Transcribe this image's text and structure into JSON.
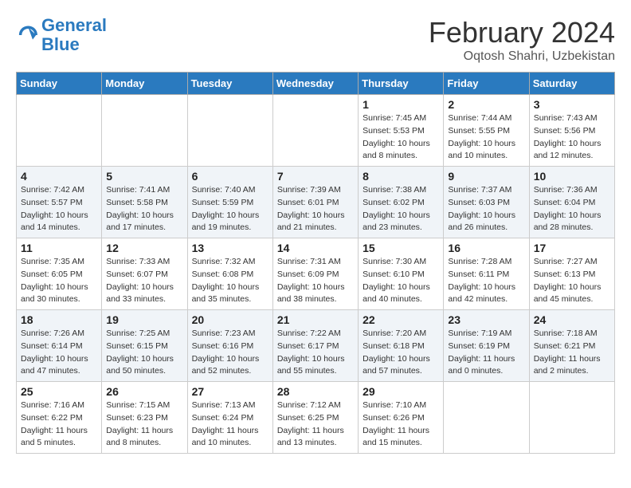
{
  "header": {
    "logo_line1": "General",
    "logo_line2": "Blue",
    "title": "February 2024",
    "subtitle": "Oqtosh Shahri, Uzbekistan"
  },
  "days_of_week": [
    "Sunday",
    "Monday",
    "Tuesday",
    "Wednesday",
    "Thursday",
    "Friday",
    "Saturday"
  ],
  "weeks": [
    [
      {
        "day": "",
        "info": ""
      },
      {
        "day": "",
        "info": ""
      },
      {
        "day": "",
        "info": ""
      },
      {
        "day": "",
        "info": ""
      },
      {
        "day": "1",
        "info": "Sunrise: 7:45 AM\nSunset: 5:53 PM\nDaylight: 10 hours\nand 8 minutes."
      },
      {
        "day": "2",
        "info": "Sunrise: 7:44 AM\nSunset: 5:55 PM\nDaylight: 10 hours\nand 10 minutes."
      },
      {
        "day": "3",
        "info": "Sunrise: 7:43 AM\nSunset: 5:56 PM\nDaylight: 10 hours\nand 12 minutes."
      }
    ],
    [
      {
        "day": "4",
        "info": "Sunrise: 7:42 AM\nSunset: 5:57 PM\nDaylight: 10 hours\nand 14 minutes."
      },
      {
        "day": "5",
        "info": "Sunrise: 7:41 AM\nSunset: 5:58 PM\nDaylight: 10 hours\nand 17 minutes."
      },
      {
        "day": "6",
        "info": "Sunrise: 7:40 AM\nSunset: 5:59 PM\nDaylight: 10 hours\nand 19 minutes."
      },
      {
        "day": "7",
        "info": "Sunrise: 7:39 AM\nSunset: 6:01 PM\nDaylight: 10 hours\nand 21 minutes."
      },
      {
        "day": "8",
        "info": "Sunrise: 7:38 AM\nSunset: 6:02 PM\nDaylight: 10 hours\nand 23 minutes."
      },
      {
        "day": "9",
        "info": "Sunrise: 7:37 AM\nSunset: 6:03 PM\nDaylight: 10 hours\nand 26 minutes."
      },
      {
        "day": "10",
        "info": "Sunrise: 7:36 AM\nSunset: 6:04 PM\nDaylight: 10 hours\nand 28 minutes."
      }
    ],
    [
      {
        "day": "11",
        "info": "Sunrise: 7:35 AM\nSunset: 6:05 PM\nDaylight: 10 hours\nand 30 minutes."
      },
      {
        "day": "12",
        "info": "Sunrise: 7:33 AM\nSunset: 6:07 PM\nDaylight: 10 hours\nand 33 minutes."
      },
      {
        "day": "13",
        "info": "Sunrise: 7:32 AM\nSunset: 6:08 PM\nDaylight: 10 hours\nand 35 minutes."
      },
      {
        "day": "14",
        "info": "Sunrise: 7:31 AM\nSunset: 6:09 PM\nDaylight: 10 hours\nand 38 minutes."
      },
      {
        "day": "15",
        "info": "Sunrise: 7:30 AM\nSunset: 6:10 PM\nDaylight: 10 hours\nand 40 minutes."
      },
      {
        "day": "16",
        "info": "Sunrise: 7:28 AM\nSunset: 6:11 PM\nDaylight: 10 hours\nand 42 minutes."
      },
      {
        "day": "17",
        "info": "Sunrise: 7:27 AM\nSunset: 6:13 PM\nDaylight: 10 hours\nand 45 minutes."
      }
    ],
    [
      {
        "day": "18",
        "info": "Sunrise: 7:26 AM\nSunset: 6:14 PM\nDaylight: 10 hours\nand 47 minutes."
      },
      {
        "day": "19",
        "info": "Sunrise: 7:25 AM\nSunset: 6:15 PM\nDaylight: 10 hours\nand 50 minutes."
      },
      {
        "day": "20",
        "info": "Sunrise: 7:23 AM\nSunset: 6:16 PM\nDaylight: 10 hours\nand 52 minutes."
      },
      {
        "day": "21",
        "info": "Sunrise: 7:22 AM\nSunset: 6:17 PM\nDaylight: 10 hours\nand 55 minutes."
      },
      {
        "day": "22",
        "info": "Sunrise: 7:20 AM\nSunset: 6:18 PM\nDaylight: 10 hours\nand 57 minutes."
      },
      {
        "day": "23",
        "info": "Sunrise: 7:19 AM\nSunset: 6:19 PM\nDaylight: 11 hours\nand 0 minutes."
      },
      {
        "day": "24",
        "info": "Sunrise: 7:18 AM\nSunset: 6:21 PM\nDaylight: 11 hours\nand 2 minutes."
      }
    ],
    [
      {
        "day": "25",
        "info": "Sunrise: 7:16 AM\nSunset: 6:22 PM\nDaylight: 11 hours\nand 5 minutes."
      },
      {
        "day": "26",
        "info": "Sunrise: 7:15 AM\nSunset: 6:23 PM\nDaylight: 11 hours\nand 8 minutes."
      },
      {
        "day": "27",
        "info": "Sunrise: 7:13 AM\nSunset: 6:24 PM\nDaylight: 11 hours\nand 10 minutes."
      },
      {
        "day": "28",
        "info": "Sunrise: 7:12 AM\nSunset: 6:25 PM\nDaylight: 11 hours\nand 13 minutes."
      },
      {
        "day": "29",
        "info": "Sunrise: 7:10 AM\nSunset: 6:26 PM\nDaylight: 11 hours\nand 15 minutes."
      },
      {
        "day": "",
        "info": ""
      },
      {
        "day": "",
        "info": ""
      }
    ]
  ]
}
